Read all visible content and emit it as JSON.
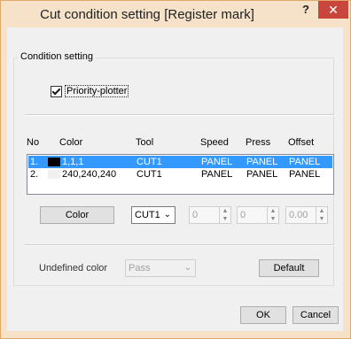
{
  "window": {
    "title": "Cut condition setting [Register mark]",
    "help_label": "?",
    "close_label": "✕"
  },
  "group": {
    "label": "Condition setting",
    "checkbox_label": "Priority-plotter",
    "checkbox_checked": true
  },
  "table": {
    "headers": {
      "no": "No",
      "color": "Color",
      "tool": "Tool",
      "speed": "Speed",
      "press": "Press",
      "offset": "Offset"
    },
    "rows": [
      {
        "no": "1.",
        "swatch": "#010101",
        "color": "1,1,1",
        "tool": "CUT1",
        "speed": "PANEL",
        "press": "PANEL",
        "offset": "PANEL",
        "selected": true
      },
      {
        "no": "2.",
        "swatch": "#f0f0f0",
        "color": "240,240,240",
        "tool": "CUT1",
        "speed": "PANEL",
        "press": "PANEL",
        "offset": "PANEL",
        "selected": false
      }
    ]
  },
  "controls": {
    "color_button": "Color",
    "tool_value": "CUT1",
    "speed_value": "0",
    "press_value": "0",
    "offset_value": "0.00"
  },
  "undefined": {
    "label": "Undefined color",
    "value": "Pass",
    "default_button": "Default"
  },
  "footer": {
    "ok": "OK",
    "cancel": "Cancel"
  },
  "colors": {
    "selection": "#3399ff",
    "title_bg": "#f6e2c8",
    "close_bg": "#c9463d"
  }
}
